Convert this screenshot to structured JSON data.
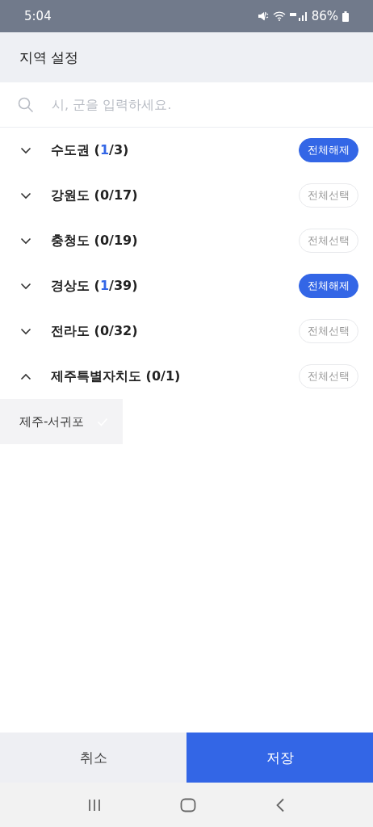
{
  "status_bar": {
    "time": "5:04",
    "battery": "86%"
  },
  "header": {
    "title": "지역 설정"
  },
  "search": {
    "placeholder": "시, 군을 입력하세요."
  },
  "regions": [
    {
      "label_before": "수도권 (",
      "count": "1",
      "label_after": "/3)",
      "has_selection": true,
      "expanded": false,
      "action": "전체해제"
    },
    {
      "label_before": "강원도 (",
      "count": "0",
      "label_after": "/17)",
      "has_selection": false,
      "expanded": false,
      "action": "전체선택"
    },
    {
      "label_before": "충청도 (",
      "count": "0",
      "label_after": "/19)",
      "has_selection": false,
      "expanded": false,
      "action": "전체선택"
    },
    {
      "label_before": "경상도 (",
      "count": "1",
      "label_after": "/39)",
      "has_selection": true,
      "expanded": false,
      "action": "전체해제"
    },
    {
      "label_before": "전라도 (",
      "count": "0",
      "label_after": "/32)",
      "has_selection": false,
      "expanded": false,
      "action": "전체선택"
    },
    {
      "label_before": "제주특별자치도 (",
      "count": "0",
      "label_after": "/1)",
      "has_selection": false,
      "expanded": true,
      "action": "전체선택",
      "children": [
        {
          "label": "제주-서귀포",
          "checked": false
        }
      ]
    }
  ],
  "buttons": {
    "cancel": "취소",
    "save": "저장"
  }
}
